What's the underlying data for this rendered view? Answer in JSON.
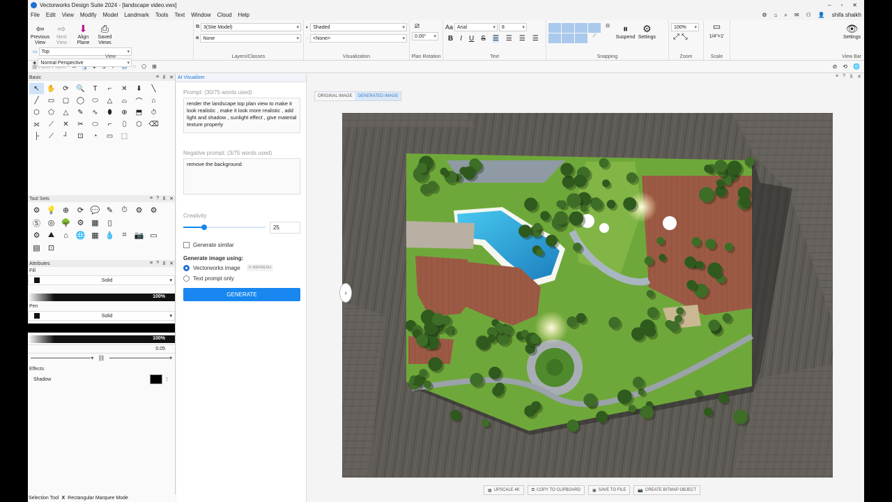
{
  "window": {
    "title": "Vectorworks Design Suite 2024 - [landscape video.vwx]",
    "controls": [
      "–",
      "▫",
      "✕"
    ]
  },
  "menu": {
    "items": [
      "File",
      "Edit",
      "View",
      "Modify",
      "Model",
      "Landmark",
      "Tools",
      "Text",
      "Window",
      "Cloud",
      "Help"
    ],
    "user": "shifa shaikh"
  },
  "ribbon": {
    "view": {
      "group_label": "View",
      "previous": "Previous View",
      "next": "Next View",
      "align": "Align Plane",
      "saved": "Saved Views",
      "view_select": "Top",
      "projection_select": "Normal Perspective"
    },
    "layers": {
      "group_label": "Layers/Classes",
      "layer": "3(Site Model)",
      "class": "None"
    },
    "visualization": {
      "group_label": "Visualization",
      "render_mode": "Shaded",
      "secondary": "<None>"
    },
    "plan_rotation": {
      "group_label": "Plan Rotation",
      "value": "0.00°"
    },
    "text": {
      "group_label": "Text",
      "font": "Arial",
      "size": "8",
      "bold": "B",
      "italic": "I",
      "underline": "U",
      "strike": "S"
    },
    "snapping": {
      "group_label": "Snapping",
      "suspend": "Suspend",
      "settings": "Settings"
    },
    "zoom": {
      "group_label": "Zoom",
      "value": "100%"
    },
    "scale": {
      "group_label": "Scale",
      "value": "1/4\"=1'"
    },
    "viewbar": {
      "group_label": "View Bar",
      "settings": "Settings"
    }
  },
  "toolbar": {
    "auto_plane": "Auto-Plane"
  },
  "basic_palette": {
    "title": "Basic",
    "tools": [
      "↖",
      "✋",
      "⟳",
      "🔍",
      "T",
      "⌐",
      "✕",
      "⬇",
      "╲",
      "╱",
      "▭",
      "▢",
      "◯",
      "⬭",
      "△",
      "⌓",
      "⌒",
      "⌂",
      "⬡",
      "⬠",
      "△",
      "✎",
      "∿",
      "⬮",
      "⊕",
      "⬒",
      "⏱",
      "⟗",
      "⟋",
      "✕",
      "✂",
      "⬭",
      "⌐",
      "⬯",
      "⬡",
      "⌫",
      "├",
      "⟋",
      "┘",
      "⊡",
      "◔",
      "▭",
      "⬚"
    ]
  },
  "tool_sets": {
    "title": "Tool Sets",
    "icons": [
      "⚙",
      "💡",
      "⊕",
      "⟳",
      "💬",
      "✎",
      "⏱",
      "⚙",
      "⚙",
      "Ⓢ",
      "◎",
      "🌳",
      "⚙",
      "▦",
      "▯",
      "",
      "",
      "",
      "⚙",
      "⛰",
      "⌂",
      "🌐",
      "▦",
      "💧",
      "⌗",
      "📷",
      "▭",
      "▤",
      "⊡"
    ]
  },
  "attributes": {
    "title": "Attributes",
    "fill_label": "Fill",
    "fill_style": "Solid",
    "fill_opacity": "100%",
    "pen_label": "Pen",
    "pen_style": "Solid",
    "pen_opacity": "100%",
    "line_weight": "0.05",
    "effects_label": "Effects",
    "shadow_label": "Shadow"
  },
  "ai_visualizer": {
    "tab_title": "AI Visualizer",
    "prompt_label": "Prompt: (30/75 words used)",
    "prompt_text": "render the landscape top plan view  to make it look realistic , make it look more realistic , add light and shadow , sunlight effect , give material texture properly",
    "negative_label": "Negative prompt: (3/75 words used)",
    "negative_text": "remove the background",
    "creativity_label": "Creativity",
    "creativity_value": "25",
    "creativity_fraction": 0.25,
    "generate_similar": "Generate similar",
    "generate_using_label": "Generate image using:",
    "option_vectorworks": "Vectorworks image",
    "refresh_label": "REFRESH",
    "option_text": "Text prompt only",
    "generate_button": "GENERATE"
  },
  "viewer": {
    "tab_original": "ORIGINAL IMAGE",
    "tab_generated": "GENERATED IMAGE",
    "buttons": [
      "UPSCALE 4K",
      "COPY TO CLIPBOARD",
      "SAVE TO FILE",
      "CREATE BITMAP OBJECT"
    ]
  },
  "status": {
    "tool": "Selection Tool",
    "mode_prefix": "X",
    "mode": "Rectangular Marquee Mode"
  },
  "colors": {
    "accent": "#1987f0",
    "pool": "#2bb0e0",
    "lawn": "#6fa83a",
    "deck": "#5c5854",
    "roof": "#a0604a"
  }
}
